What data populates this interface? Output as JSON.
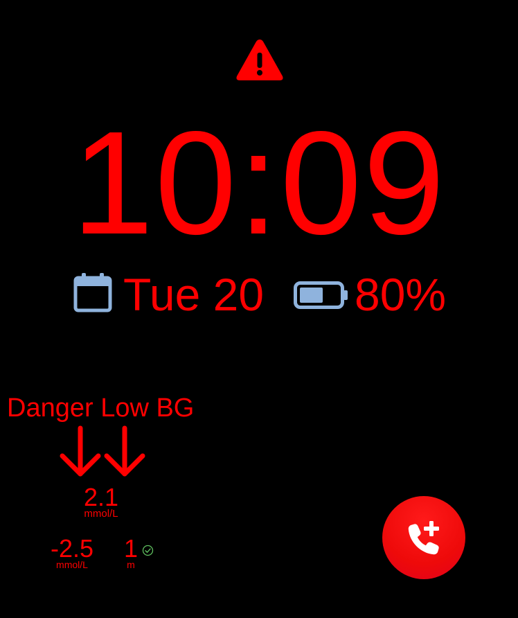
{
  "colors": {
    "background": "#000000",
    "alert_red": "#ff0000",
    "icon_blue": "#8fb3dd",
    "check_green": "#5fbf5f",
    "call_button": "#ee0a0a"
  },
  "icons": {
    "warning": "warning-triangle-icon",
    "calendar": "calendar-icon",
    "battery": "battery-icon",
    "trend": "double-down-arrow-icon",
    "check": "check-circle-icon",
    "call": "phone-plus-icon"
  },
  "clock": {
    "time": "10:09"
  },
  "status": {
    "date": "Tue 20",
    "battery_percent": "80%",
    "battery_level": 0.8
  },
  "glucose": {
    "alert_label": "Danger Low BG",
    "value": "2.1",
    "value_unit": "mmol/L",
    "delta": "-2.5",
    "delta_unit": "mmol/L",
    "age": "1",
    "age_unit": "m"
  }
}
